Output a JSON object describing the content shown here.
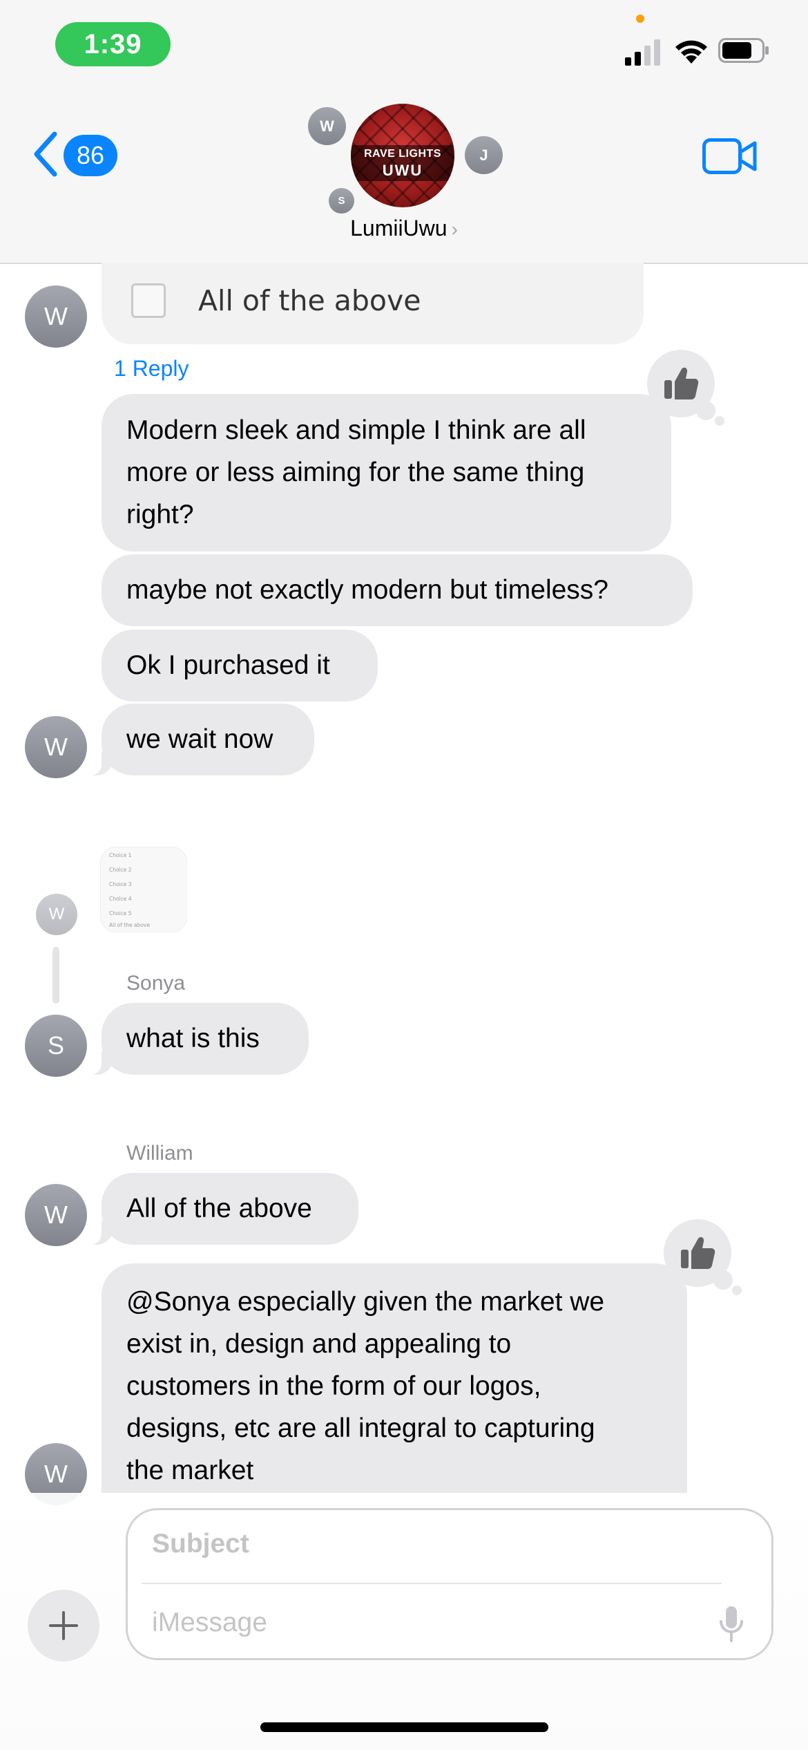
{
  "status_bar": {
    "time": "1:39"
  },
  "header": {
    "back_count": "86",
    "group_name": "LumiiUwu",
    "group_photo_line1": "RAVE LIGHTS",
    "group_photo_line2": "UWU",
    "participant_initials": [
      "W",
      "J",
      "S"
    ]
  },
  "messages": {
    "top_preview_label": "All of the above",
    "reply_count_label": "1 Reply",
    "m1": [
      "Modern sleek and simple I think are all",
      "more or less aiming for the same thing",
      "right?"
    ],
    "m2": "maybe not exactly modern but timeless?",
    "m3": "Ok I purchased it",
    "m4": "we wait now",
    "thumb_rows": [
      "Choice 1",
      "Choice 2",
      "Choice 3",
      "Choice 4",
      "Choice 5",
      "All of the above"
    ],
    "sender_sonya": "Sonya",
    "m5": "what is this",
    "sender_william": "William",
    "m6": "All of the above",
    "m7": [
      "@Sonya especially given the market we",
      "exist in, design and appealing to",
      "customers in the form of our logos,",
      "designs, etc are all integral to capturing",
      "the market"
    ],
    "avatar_w": "W",
    "avatar_s": "S"
  },
  "compose": {
    "subject_placeholder": "Subject",
    "message_placeholder": "iMessage"
  },
  "colors": {
    "accent": "#0a84ff",
    "time_pill": "#34c759",
    "bubble": "#e9e9eb",
    "privacy_dot": "#ff9f0a"
  },
  "icons": {
    "back": "chevron-left-icon",
    "video": "video-camera-icon",
    "tapback": "thumbs-up-icon",
    "plus": "plus-icon",
    "mic": "microphone-icon",
    "signal": "cellular-signal-icon",
    "wifi": "wifi-icon",
    "battery": "battery-icon"
  }
}
